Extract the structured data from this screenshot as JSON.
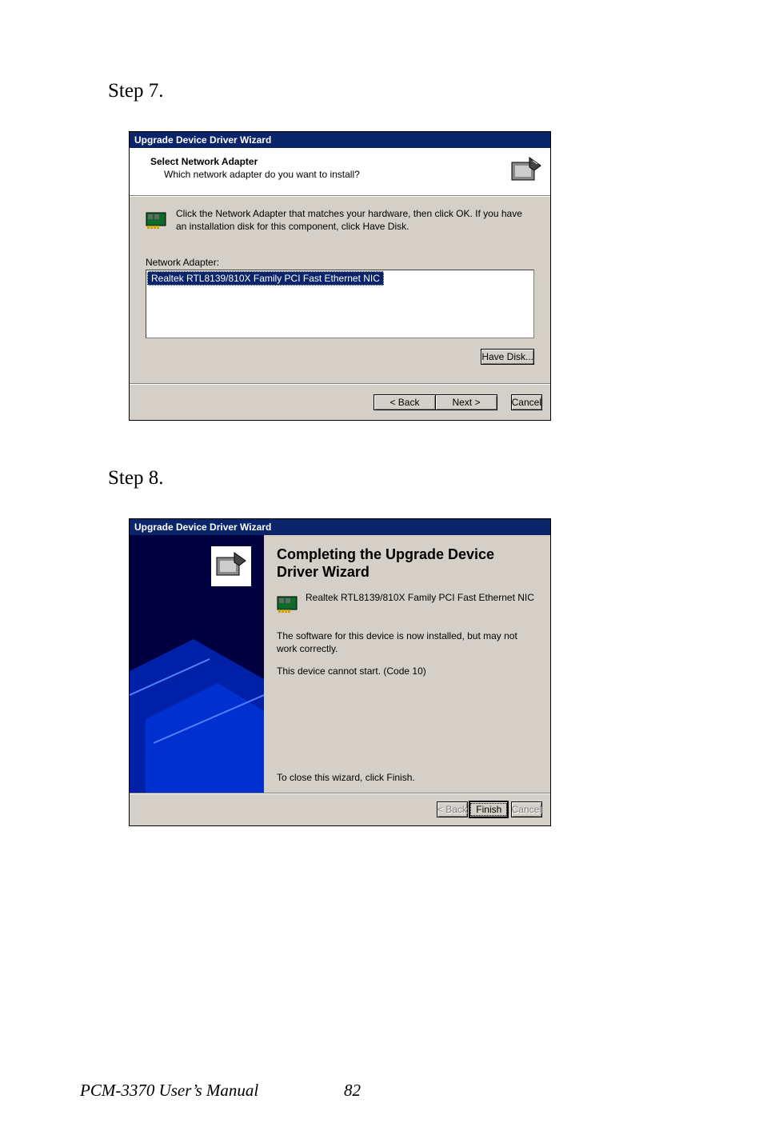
{
  "step7_label": "Step 7.",
  "step8_label": "Step 8.",
  "dialog1": {
    "title": "Upgrade Device Driver Wizard",
    "header_title": "Select Network Adapter",
    "header_subtitle": "Which network adapter do you want to install?",
    "info_text": "Click the Network Adapter that matches your hardware, then click OK. If you have an installation disk for this component, click Have Disk.",
    "list_label": "Network Adapter:",
    "list_item": "Realtek RTL8139/810X Family PCI Fast Ethernet NIC",
    "have_disk": "Have Disk...",
    "back": "< Back",
    "next": "Next >",
    "cancel": "Cancel"
  },
  "dialog2": {
    "title": "Upgrade Device Driver Wizard",
    "heading": "Completing the Upgrade Device Driver Wizard",
    "device_name": "Realtek RTL8139/810X Family PCI Fast Ethernet NIC",
    "msg1": "The software for this device is now installed, but may not work correctly.",
    "msg2": "This device cannot start. (Code 10)",
    "close_hint": "To close this wizard, click Finish.",
    "back": "< Back",
    "finish": "Finish",
    "cancel": "Cancel"
  },
  "footer": {
    "manual": "PCM-3370 User’s Manual",
    "page": "82"
  }
}
